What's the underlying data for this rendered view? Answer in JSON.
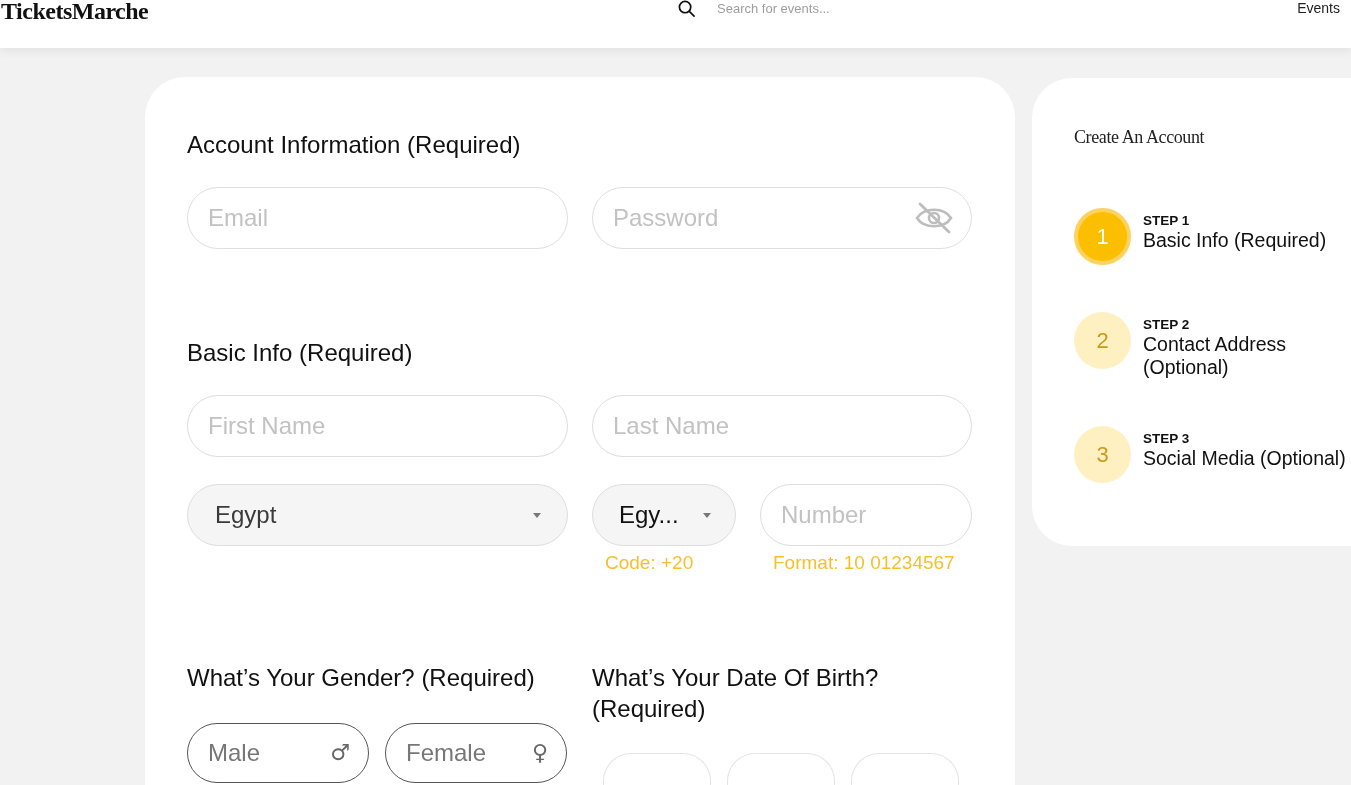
{
  "header": {
    "logo": "TicketsMarche",
    "search": {
      "placeholder": "Search for events..."
    },
    "nav": [
      {
        "label": "Events"
      }
    ]
  },
  "form": {
    "sections": [
      {
        "title": "Account Information (Required)",
        "rows": [
          [
            {
              "kind": "text",
              "placeholder": "Email"
            },
            {
              "kind": "password",
              "placeholder": "Password"
            }
          ]
        ]
      },
      {
        "title": "Basic Info (Required)",
        "rows": [
          [
            {
              "kind": "text",
              "placeholder": "First Name"
            },
            {
              "kind": "text",
              "placeholder": "Last Name"
            }
          ],
          [
            {
              "kind": "select",
              "value": "Egypt"
            },
            {
              "kind": "select",
              "value": "Egy...",
              "hint": "Code: +20"
            },
            {
              "kind": "text",
              "placeholder": "Number",
              "hint": "Format: 10 01234567"
            }
          ]
        ]
      }
    ],
    "gender": {
      "label": "What’s Your Gender? (Required)",
      "options": [
        {
          "label": "Male",
          "symbol": "♂",
          "selected": false
        },
        {
          "label": "Female",
          "symbol": "♀",
          "selected": false
        }
      ]
    },
    "date_of_birth": {
      "label": "What’s Your Date Of Birth? (Required)",
      "fields": [
        {
          "kind": "input"
        },
        {
          "kind": "input"
        },
        {
          "kind": "input"
        }
      ]
    }
  },
  "steps_panel": {
    "title": "Create An Account",
    "steps": [
      {
        "label": "STEP 1",
        "number": "1",
        "title": "Basic Info (Required)",
        "current": true
      },
      {
        "label": "STEP 2",
        "number": "2",
        "title": "Contact Address (Optional)",
        "current": false
      },
      {
        "label": "STEP 3",
        "number": "3",
        "title": "Social Media (Optional)",
        "current": false
      }
    ]
  }
}
